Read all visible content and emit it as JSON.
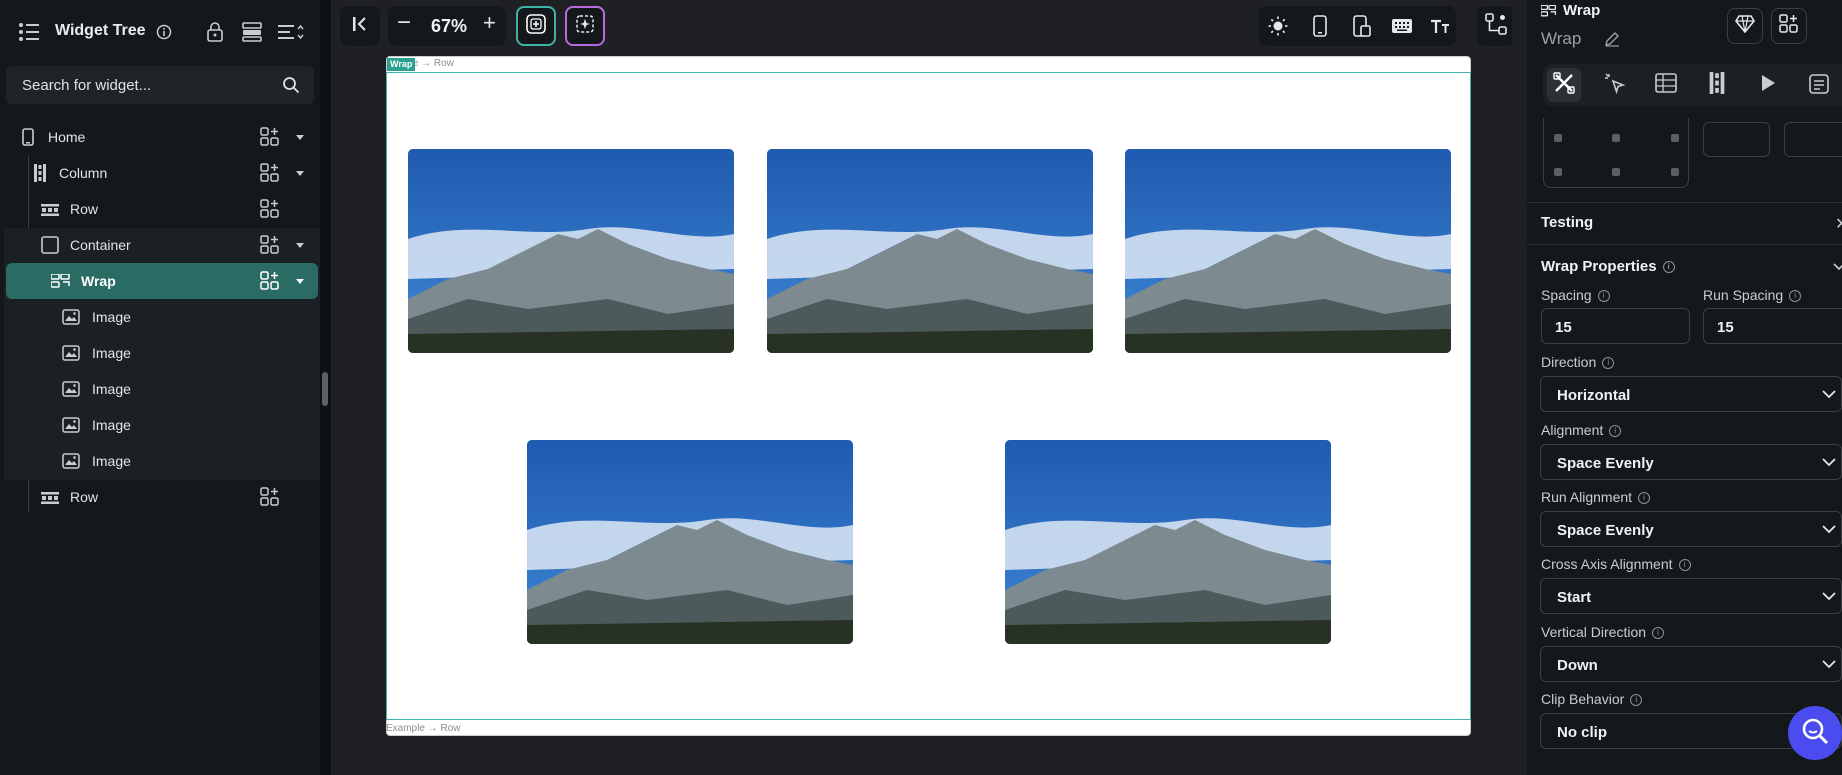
{
  "sidebar": {
    "title": "Widget Tree",
    "search_placeholder": "Search for widget...",
    "items": [
      {
        "label": "Home"
      },
      {
        "label": "Column"
      },
      {
        "label": "Row"
      },
      {
        "label": "Container"
      },
      {
        "label": "Wrap"
      },
      {
        "label": "Image"
      },
      {
        "label": "Image"
      },
      {
        "label": "Image"
      },
      {
        "label": "Image"
      },
      {
        "label": "Image"
      },
      {
        "label": "Row"
      }
    ]
  },
  "toolbar": {
    "zoom": "67%",
    "zoom_out_symbol": "−",
    "zoom_in_symbol": "+"
  },
  "canvas": {
    "wrap_tag": "Wrap",
    "top_breadcrumb_tail": "ple → Row",
    "bottom_breadcrumb": "Example → Row"
  },
  "panel": {
    "widget_type": "Wrap",
    "widget_name": "Wrap",
    "testing": "Testing",
    "wrap_properties": "Wrap Properties",
    "spacing_label": "Spacing",
    "spacing_value": "15",
    "run_spacing_label": "Run Spacing",
    "run_spacing_value": "15",
    "direction_label": "Direction",
    "direction_value": "Horizontal",
    "alignment_label": "Alignment",
    "alignment_value": "Space Evenly",
    "run_alignment_label": "Run Alignment",
    "run_alignment_value": "Space Evenly",
    "cross_axis_label": "Cross Axis Alignment",
    "cross_axis_value": "Start",
    "vertical_direction_label": "Vertical Direction",
    "vertical_direction_value": "Down",
    "clip_behavior_label": "Clip Behavior",
    "clip_behavior_value": "No clip"
  },
  "colors": {
    "accent": "#2a6b63",
    "selection_border": "#3fb3a8",
    "help_button": "#4a4cf0"
  }
}
